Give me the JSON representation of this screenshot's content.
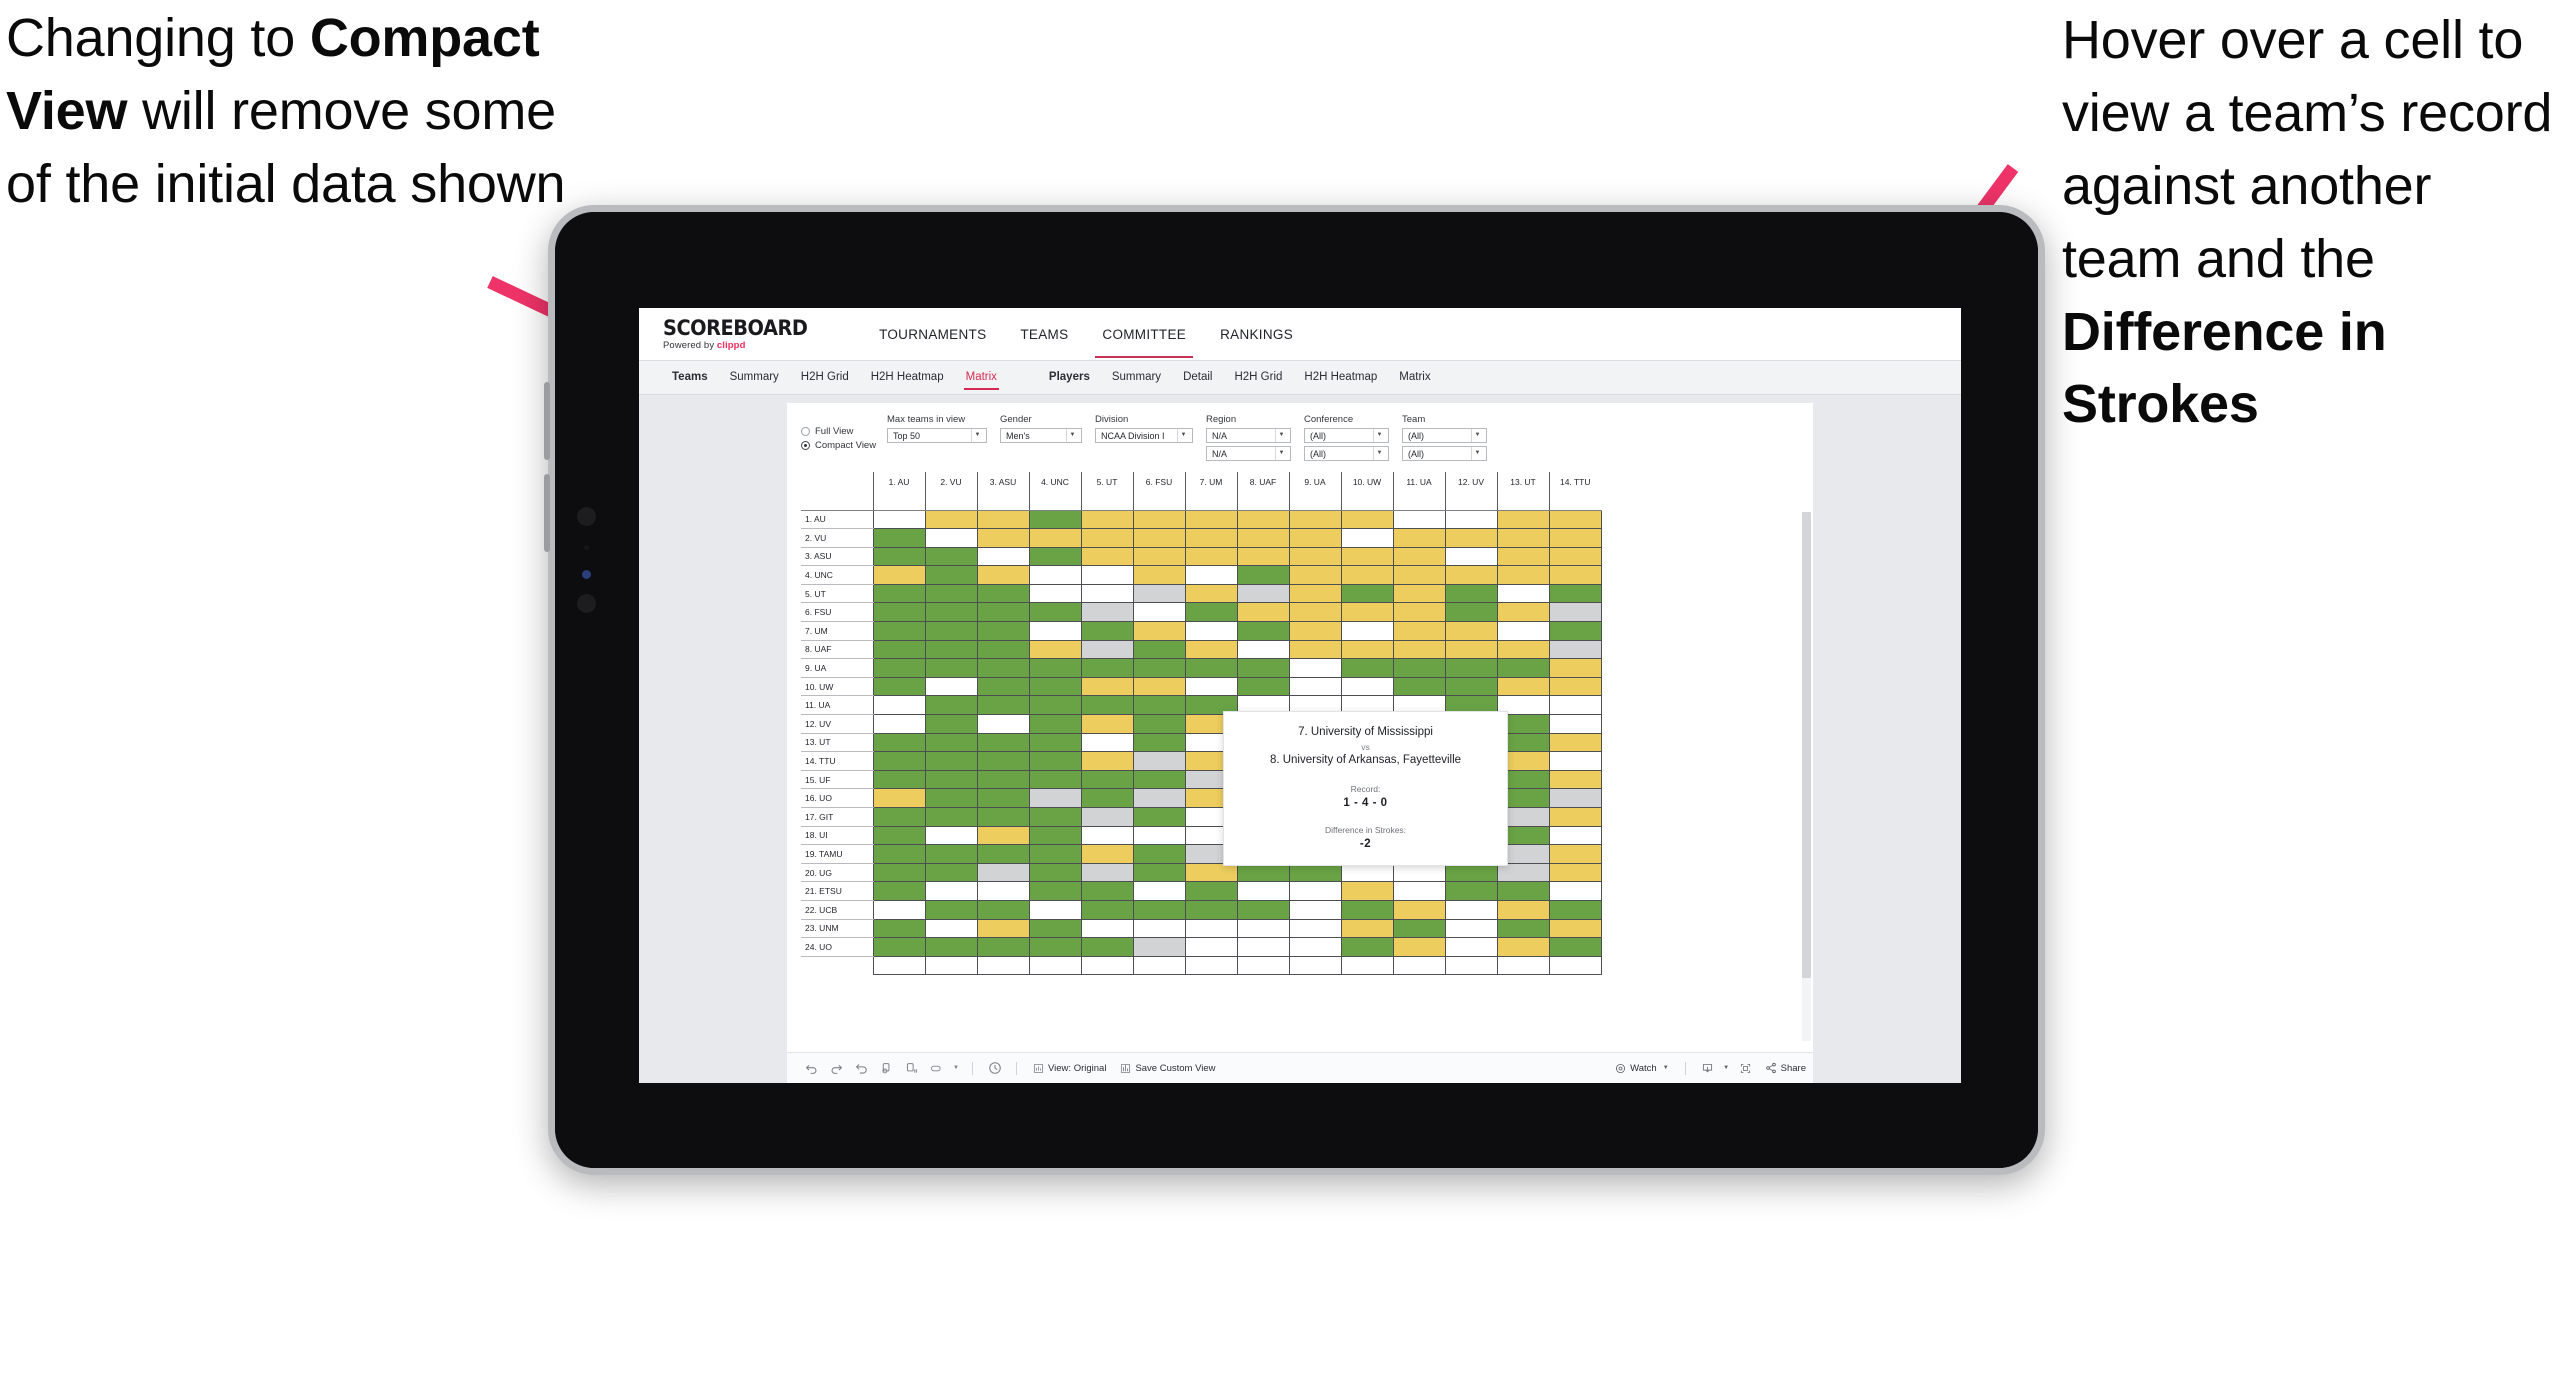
{
  "annotations": {
    "left": {
      "pre": "Changing to ",
      "bold": "Compact View",
      "post": " will remove some of the initial data shown"
    },
    "right": {
      "pre": "Hover over a cell to view a team’s record against another team and the ",
      "bold": "Difference in Strokes",
      "post": ""
    },
    "arrow_color": "#ee3368"
  },
  "app": {
    "brand": {
      "title": "SCOREBOARD",
      "powered_prefix": "Powered by ",
      "powered_name": "clippd"
    },
    "main_nav": [
      {
        "label": "TOURNAMENTS",
        "active": false
      },
      {
        "label": "TEAMS",
        "active": false
      },
      {
        "label": "COMMITTEE",
        "active": true
      },
      {
        "label": "RANKINGS",
        "active": false
      }
    ],
    "sub_nav": {
      "teams_group": [
        {
          "label": "Teams",
          "head": true,
          "active": false
        },
        {
          "label": "Summary",
          "head": false,
          "active": false
        },
        {
          "label": "H2H Grid",
          "head": false,
          "active": false
        },
        {
          "label": "H2H Heatmap",
          "head": false,
          "active": false
        },
        {
          "label": "Matrix",
          "head": false,
          "active": true
        }
      ],
      "players_group": [
        {
          "label": "Players",
          "head": true,
          "active": false
        },
        {
          "label": "Summary",
          "head": false,
          "active": false
        },
        {
          "label": "Detail",
          "head": false,
          "active": false
        },
        {
          "label": "H2H Grid",
          "head": false,
          "active": false
        },
        {
          "label": "H2H Heatmap",
          "head": false,
          "active": false
        },
        {
          "label": "Matrix",
          "head": false,
          "active": false
        }
      ]
    },
    "filters": {
      "view_mode": {
        "options": [
          {
            "label": "Full View",
            "selected": false
          },
          {
            "label": "Compact View",
            "selected": true
          }
        ]
      },
      "selects": [
        {
          "label": "Max teams in view",
          "value": "Top 50",
          "width_class": "w-top50"
        },
        {
          "label": "Gender",
          "value": "Men's",
          "width_class": "w-gender"
        },
        {
          "label": "Division",
          "value": "NCAA Division I",
          "width_class": "w-division"
        },
        {
          "label": "Region",
          "value": "N/A",
          "value2": "N/A",
          "width_class": "w-region"
        },
        {
          "label": "Conference",
          "value": "(All)",
          "value2": "(All)",
          "width_class": "w-conf"
        },
        {
          "label": "Team",
          "value": "(All)",
          "value2": "(All)",
          "width_class": "w-team"
        }
      ]
    },
    "tooltip": {
      "team_a": "7. University of Mississippi",
      "vs": "vs",
      "team_b": "8. University of Arkansas, Fayetteville",
      "record_caption": "Record:",
      "record_value": "1 - 4 - 0",
      "strokes_caption": "Difference in Strokes:",
      "strokes_value": "-2"
    },
    "toolbar": {
      "icons": [
        "undo-icon",
        "redo-icon",
        "revert-icon",
        "refresh-icon",
        "pause-icon",
        "alerts-icon"
      ],
      "clock_icon": "history-icon",
      "view_original_label": "View: Original",
      "save_custom_view_label": "Save Custom View",
      "watch_label": "Watch",
      "share_label": "Share",
      "download_icon": "download-icon",
      "fullscreen_icon": "fullscreen-icon",
      "share_icon": "share-icon"
    }
  },
  "chart_data": {
    "type": "heatmap",
    "title": "Head-to-Head Team Matrix",
    "xlabel": "",
    "ylabel": "",
    "grid": true,
    "legend_position": "none",
    "colors": {
      "win": "#69a346",
      "loss": "#eccd5d",
      "tie": "#d2d3d5",
      "none": "#ffffff"
    },
    "columns": [
      "1. AU",
      "2. VU",
      "3. ASU",
      "4. UNC",
      "5. UT",
      "6. FSU",
      "7. UM",
      "8. UAF",
      "9. UA",
      "10. UW",
      "11. UA",
      "12. UV",
      "13. UT",
      "14. TTU"
    ],
    "rows": [
      "1. AU",
      "2. VU",
      "3. ASU",
      "4. UNC",
      "5. UT",
      "6. FSU",
      "7. UM",
      "8. UAF",
      "9. UA",
      "10. UW",
      "11. UA",
      "12. UV",
      "13. UT",
      "14. TTU",
      "15. UF",
      "16. UO",
      "17. GIT",
      "18. UI",
      "19. TAMU",
      "20. UG",
      "21. ETSU",
      "22. UCB",
      "23. UNM",
      "24. UO"
    ],
    "highlight_cell": {
      "row": "8. UAF",
      "col": "7. UM"
    },
    "cells": [
      [
        "n",
        "y",
        "y",
        "g",
        "y",
        "y",
        "y",
        "y",
        "y",
        "y",
        "n",
        "n",
        "y",
        "y"
      ],
      [
        "g",
        "n",
        "y",
        "y",
        "y",
        "y",
        "y",
        "y",
        "y",
        "n",
        "y",
        "y",
        "y",
        "y"
      ],
      [
        "g",
        "g",
        "n",
        "g",
        "y",
        "y",
        "y",
        "y",
        "y",
        "y",
        "y",
        "n",
        "y",
        "y"
      ],
      [
        "y",
        "g",
        "y",
        "n",
        "n",
        "y",
        "n",
        "g",
        "y",
        "y",
        "y",
        "y",
        "y",
        "y"
      ],
      [
        "g",
        "g",
        "g",
        "n",
        "n",
        "s",
        "y",
        "s",
        "y",
        "g",
        "y",
        "g",
        "n",
        "g"
      ],
      [
        "g",
        "g",
        "g",
        "g",
        "s",
        "n",
        "g",
        "y",
        "y",
        "y",
        "y",
        "g",
        "y",
        "s"
      ],
      [
        "g",
        "g",
        "g",
        "n",
        "g",
        "y",
        "n",
        "g",
        "y",
        "n",
        "y",
        "y",
        "n",
        "g"
      ],
      [
        "g",
        "g",
        "g",
        "y",
        "s",
        "g",
        "y",
        "n",
        "y",
        "y",
        "y",
        "y",
        "y",
        "s"
      ],
      [
        "g",
        "g",
        "g",
        "g",
        "g",
        "g",
        "g",
        "g",
        "n",
        "g",
        "g",
        "g",
        "g",
        "y"
      ],
      [
        "g",
        "n",
        "g",
        "g",
        "y",
        "y",
        "n",
        "g",
        "n",
        "n",
        "g",
        "g",
        "y",
        "y"
      ],
      [
        "n",
        "g",
        "g",
        "g",
        "g",
        "g",
        "g",
        "n",
        "n",
        "n",
        "n",
        "g",
        "n",
        "n"
      ],
      [
        "n",
        "g",
        "n",
        "g",
        "y",
        "g",
        "y",
        "g",
        "n",
        "n",
        "n",
        "n",
        "g",
        "n"
      ],
      [
        "g",
        "g",
        "g",
        "g",
        "n",
        "g",
        "n",
        "g",
        "g",
        "g",
        "g",
        "n",
        "g",
        "y"
      ],
      [
        "g",
        "g",
        "g",
        "g",
        "y",
        "s",
        "y",
        "g",
        "g",
        "g",
        "g",
        "g",
        "y",
        "n"
      ],
      [
        "g",
        "g",
        "g",
        "g",
        "g",
        "g",
        "s",
        "g",
        "g",
        "g",
        "g",
        "g",
        "g",
        "y"
      ],
      [
        "y",
        "g",
        "g",
        "s",
        "g",
        "s",
        "y",
        "g",
        "g",
        "g",
        "g",
        "g",
        "g",
        "s"
      ],
      [
        "g",
        "g",
        "g",
        "g",
        "s",
        "g",
        "n",
        "g",
        "g",
        "g",
        "g",
        "g",
        "s",
        "y"
      ],
      [
        "g",
        "n",
        "y",
        "g",
        "n",
        "n",
        "n",
        "g",
        "g",
        "n",
        "g",
        "g",
        "g",
        "n"
      ],
      [
        "g",
        "g",
        "g",
        "g",
        "y",
        "g",
        "s",
        "g",
        "y",
        "g",
        "g",
        "g",
        "s",
        "y"
      ],
      [
        "g",
        "g",
        "s",
        "g",
        "s",
        "g",
        "y",
        "g",
        "g",
        "n",
        "n",
        "g",
        "s",
        "y"
      ],
      [
        "g",
        "n",
        "n",
        "g",
        "g",
        "n",
        "g",
        "n",
        "n",
        "y",
        "n",
        "g",
        "g",
        "n"
      ],
      [
        "n",
        "g",
        "g",
        "n",
        "g",
        "g",
        "g",
        "g",
        "n",
        "g",
        "y",
        "n",
        "y",
        "g"
      ],
      [
        "g",
        "n",
        "y",
        "g",
        "n",
        "n",
        "n",
        "n",
        "n",
        "y",
        "g",
        "n",
        "g",
        "y"
      ],
      [
        "g",
        "g",
        "g",
        "g",
        "g",
        "s",
        "n",
        "n",
        "n",
        "g",
        "y",
        "n",
        "y",
        "g"
      ]
    ]
  }
}
